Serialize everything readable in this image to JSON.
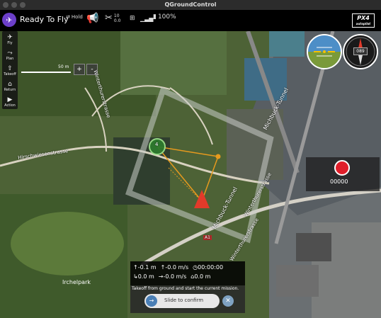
{
  "window": {
    "title": "QGroundControl"
  },
  "toolbar": {
    "status": "Ready To Fly",
    "flight_mode": "Hold",
    "gps_count": "10",
    "gps_hdop": "0.0",
    "battery": "100%"
  },
  "brand": {
    "name": "PX4",
    "sub": "autopilot"
  },
  "left_tools": [
    {
      "label": "Fly",
      "icon": "paper-plane-icon"
    },
    {
      "label": "Plan",
      "icon": "route-icon"
    },
    {
      "label": "Takeoff",
      "icon": "arrow-up-icon"
    },
    {
      "label": "Return",
      "icon": "home-icon"
    },
    {
      "label": "Action",
      "icon": "play-icon"
    }
  ],
  "map": {
    "scale": "50 m",
    "zoom_in": "+",
    "zoom_out": "-",
    "labels": {
      "street_1": "Hirschwiesenstrasse",
      "street_2": "Michbuck-Tunnel",
      "street_3": "Michbuck-Tunnel",
      "street_4": "Winterthurerstrasse",
      "street_5": "Winterthurerstrasse",
      "street_6": "Irchelpark",
      "street_7": "A1"
    },
    "vehicle_id": "4"
  },
  "instruments": {
    "heading": "089"
  },
  "camera": {
    "elapsed": "00000"
  },
  "telemetry": {
    "altitude": "-0.1 m",
    "vertical_speed": "-0.0 m/s",
    "flight_time": "00:00:00",
    "distance": "0.0 m",
    "ground_speed": "-0.0 m/s",
    "distance_home": "0.0 m"
  },
  "guided": {
    "message": "Takeoff from ground and start the current mission.",
    "slider_label": "Slide to confirm",
    "knob_symbol": "→",
    "cancel_symbol": "✕"
  }
}
